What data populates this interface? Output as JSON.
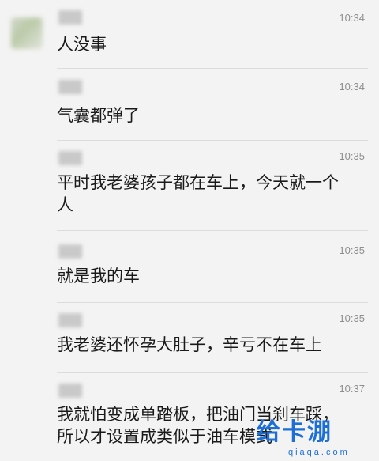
{
  "messages": [
    {
      "time": "10:34",
      "text": "人没事"
    },
    {
      "time": "10:34",
      "text": "气囊都弹了"
    },
    {
      "time": "10:35",
      "text": "平时我老婆孩子都在车上，今天就一个\n人"
    },
    {
      "time": "10:35",
      "text": "就是我的车"
    },
    {
      "time": "10:35",
      "text": "我老婆还怀孕大肚子，辛亏不在车上"
    },
    {
      "time": "10:37",
      "text": "我就怕变成单踏板，把油门当刹车踩，\n所以才设置成类似于油车模式"
    }
  ],
  "watermark": {
    "logo": "给卡淜",
    "url": "qiaqa.com"
  }
}
